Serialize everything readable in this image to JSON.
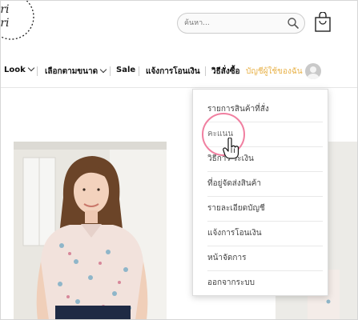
{
  "logo": {
    "text": "nari nari",
    "icon": "brand-wreath-logo"
  },
  "search": {
    "placeholder": "ค้นหา..."
  },
  "nav": {
    "items": [
      {
        "label": "Look",
        "has_dropdown": true
      },
      {
        "label": "เลือกตามขนาด",
        "has_dropdown": true
      },
      {
        "label": "Sale",
        "has_dropdown": false
      },
      {
        "label": "แจ้งการโอนเงิน",
        "has_dropdown": false
      },
      {
        "label": "วิธีสั่งซื้อ",
        "has_dropdown": false
      }
    ],
    "account_label": "บัญชีผู้ใช้ของฉัน"
  },
  "account_menu": {
    "items": [
      {
        "label": "รายการสินค้าที่สั่ง"
      },
      {
        "label": "คะแนน"
      },
      {
        "label": "วิธีการ  ระเงิน"
      },
      {
        "label": "ที่อยู่จัดส่งสินค้า"
      },
      {
        "label": "รายละเอียดบัญชี"
      },
      {
        "label": "แจ้งการโอนเงิน"
      },
      {
        "label": "หน้าจัดการ"
      },
      {
        "label": "ออกจากระบบ"
      }
    ],
    "highlighted_item": "คะแนน"
  },
  "colors": {
    "accent": "#e8b24a",
    "highlight_ring": "#f07fa0",
    "text": "#444444"
  }
}
